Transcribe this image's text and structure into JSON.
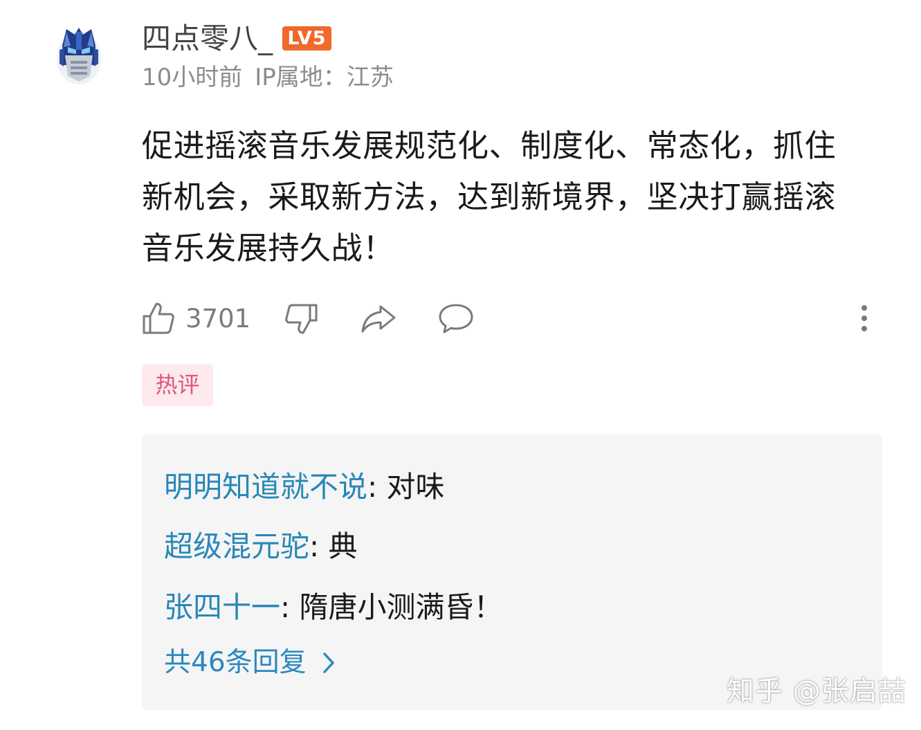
{
  "post": {
    "username": "四点零八_",
    "level_badge": "LV5",
    "time_ago": "10小时前",
    "ip_location": "IP属地：江苏",
    "content": "促进摇滚音乐发展规范化、制度化、常态化，抓住新机会，采取新方法，达到新境界，坚决打赢摇滚音乐发展持久战！",
    "like_count": "3701",
    "hot_tag": "热评"
  },
  "replies": [
    {
      "author": "明明知道就不说",
      "sep": ": ",
      "text": "对味"
    },
    {
      "author": "超级混元驼",
      "sep": ": ",
      "text": "典"
    },
    {
      "author": "张四十一",
      "sep": ": ",
      "text": "隋唐小测满昏！"
    }
  ],
  "more_replies": "共46条回复",
  "watermark": "知乎 @张启喆",
  "icons": {
    "avatar": "optimus-prime-helmet-avatar",
    "like": "thumbs-up-icon",
    "dislike": "thumbs-down-icon",
    "share": "share-arrow-icon",
    "comment": "comment-bubble-icon",
    "more": "vertical-dots-icon",
    "chevron": "chevron-right-icon"
  },
  "colors": {
    "level_badge": "#f0692a",
    "hot_tag_bg": "#fde9ee",
    "hot_tag_text": "#e0557a",
    "reply_author": "#2887b8",
    "meta_text": "#8c8c8c"
  }
}
